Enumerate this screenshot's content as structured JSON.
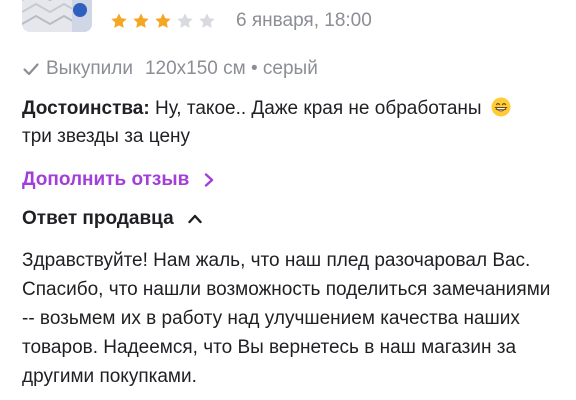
{
  "review": {
    "rating": 3,
    "rating_max": 5,
    "date": "6 января, 18:00",
    "bought_label": "Выкупили",
    "variant": "120х150 см • серый",
    "pros_label": "Достоинства:",
    "pros_text": "Ну, такое.. Даже края не обработаны",
    "pros_text_2": "три звезды за цену",
    "emoji": "grinning-face-with-smiling-eyes"
  },
  "actions": {
    "add_review_label": "Дополнить отзыв"
  },
  "seller": {
    "title": "Ответ продавца",
    "answer": "Здравствуйте! Нам жаль, что наш плед разочаровал Вас. Спасибо, что нашли возможность поделиться замечаниями -- возьмем их в работу над улучшением качества наших товаров. Надеемся, что Вы вернетесь в наш магазин за другими покупками."
  },
  "colors": {
    "star_filled": "#f5a623",
    "star_empty": "#d9dae0",
    "accent": "#a23ed9",
    "muted_text": "#8c8e96",
    "main_text": "#1f1f24"
  },
  "icons": {
    "check": "check-icon",
    "chevron_right": "chevron-right-icon",
    "chevron_up": "chevron-up-icon"
  }
}
